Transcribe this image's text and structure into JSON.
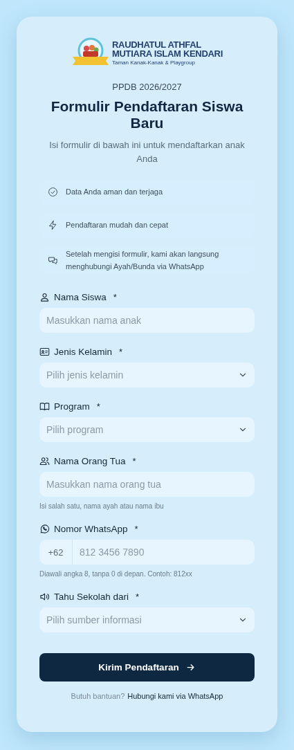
{
  "header": {
    "school_name_1": "RAUDHATUL ATHFAL",
    "school_name_2": "MUTIARA ISLAM KENDARI",
    "school_tagline": "Taman Kanak-Kanak & Playgroup",
    "period": "PPDB 2026/2027",
    "title": "Formulir Pendaftaran Siswa Baru",
    "subtitle": "Isi formulir di bawah ini untuk mendaftarkan anak Anda"
  },
  "features": [
    {
      "text": "Data Anda aman dan terjaga"
    },
    {
      "text": "Pendaftaran mudah dan cepat"
    },
    {
      "text": "Setelah mengisi formulir, kami akan langsung menghubungi Ayah/Bunda via WhatsApp"
    }
  ],
  "fields": [
    {
      "kind": "text",
      "label": "Nama Siswa",
      "required": "*",
      "placeholder": "Masukkan nama anak"
    },
    {
      "kind": "select",
      "label": "Jenis Kelamin",
      "required": "*",
      "placeholder": "Pilih jenis kelamin"
    },
    {
      "kind": "select",
      "label": "Program",
      "required": "*",
      "placeholder": "Pilih program"
    },
    {
      "kind": "text",
      "label": "Nama Orang Tua",
      "required": "*",
      "placeholder": "Masukkan nama orang tua",
      "hint": "Isi salah satu, nama ayah atau nama ibu"
    },
    {
      "kind": "phone",
      "label": "Nomor WhatsApp",
      "required": "*",
      "prefix": "+62",
      "placeholder": "812 3456 7890",
      "hint": "Diawali angka 8, tanpa 0 di depan. Contoh: 812xx"
    },
    {
      "kind": "select",
      "label": "Tahu Sekolah dari",
      "required": "*",
      "placeholder": "Pilih sumber informasi"
    }
  ],
  "submit": {
    "label": "Kirim Pendaftaran"
  },
  "footer": {
    "text": "Butuh bantuan?",
    "link": "Hubungi kami via WhatsApp"
  }
}
